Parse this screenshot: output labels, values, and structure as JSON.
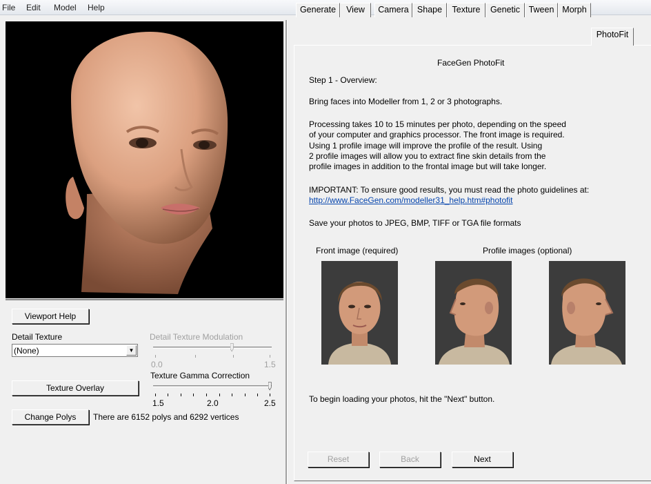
{
  "menu": [
    "File",
    "Edit",
    "Model",
    "Help"
  ],
  "left_panel": {
    "viewport_help_label": "Viewport Help",
    "detail_texture_label": "Detail Texture",
    "detail_texture_value": "(None)",
    "detail_mod_label": "Detail Texture Modulation",
    "detail_mod_min": "0.0",
    "detail_mod_max": "1.5",
    "detail_mod_value": 0.75,
    "gamma_label": "Texture Gamma Correction",
    "gamma_ticks": [
      "1.5",
      "2.0",
      "2.5"
    ],
    "gamma_value": 2.5,
    "texture_overlay_label": "Texture Overlay",
    "change_polys_label": "Change Polys",
    "polys_text": "There are 6152 polys and 6292 vertices"
  },
  "tabs": [
    {
      "label": "Generate",
      "active": false
    },
    {
      "label": "View",
      "active": false
    },
    {
      "label": "Camera",
      "active": false
    },
    {
      "label": "Shape",
      "active": false
    },
    {
      "label": "Texture",
      "active": false
    },
    {
      "label": "Genetic",
      "active": false
    },
    {
      "label": "Tween",
      "active": false
    },
    {
      "label": "Morph",
      "active": false
    },
    {
      "label": "PhotoFit",
      "active": true
    }
  ],
  "photofit": {
    "title": "FaceGen PhotoFit",
    "step": "Step 1 - Overview:",
    "intro": "Bring faces into Modeller from 1, 2 or 3 photographs.",
    "processing": [
      "Processing takes 10 to 15 minutes per photo, depending on the speed",
      "of your computer and graphics processor. The front image is required.",
      "Using 1 profile image will improve the profile of the result. Using",
      "2 profile images will allow you to extract fine skin details from the",
      "profile images in addition to the frontal image but will take longer."
    ],
    "important": "IMPORTANT: To ensure good results, you must read the photo guidelines at:",
    "link": "http://www.FaceGen.com/modeller31_help.htm#photofit",
    "formats": "Save your photos to JPEG, BMP, TIFF or TGA file formats",
    "front_label": "Front image (required)",
    "profile_label": "Profile images (optional)",
    "begin": "To begin loading your photos, hit the \"Next\" button.",
    "reset_label": "Reset",
    "back_label": "Back",
    "next_label": "Next"
  },
  "colors": {
    "viewport_bg": "#000000",
    "skin": "#e3a687",
    "photo_bg": "#3a3a3a",
    "link": "#0645ad"
  }
}
